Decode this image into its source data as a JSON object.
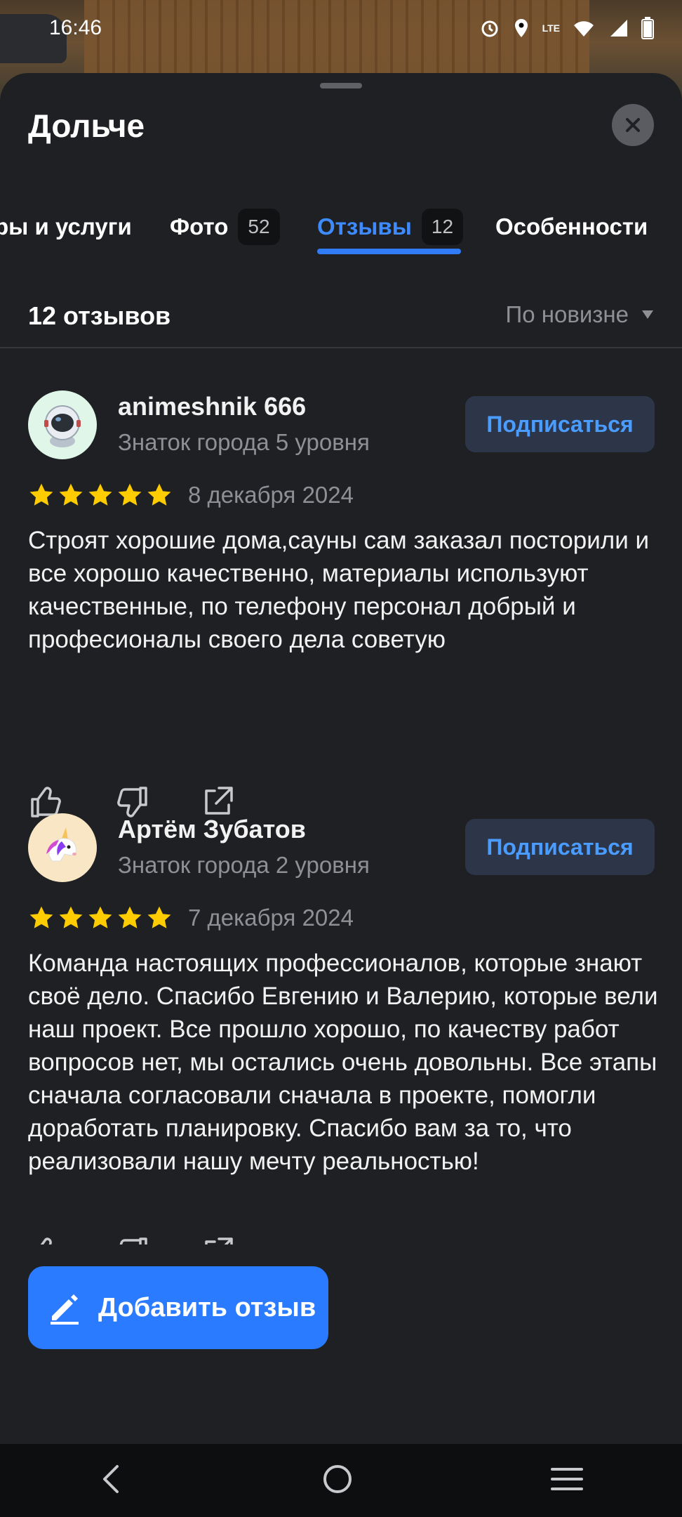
{
  "status_bar": {
    "time": "16:46",
    "network": "LTE"
  },
  "sheet": {
    "title": "Дольче"
  },
  "tabs": [
    {
      "label": "ры и услуги",
      "count": ""
    },
    {
      "label": "Фото",
      "count": "52"
    },
    {
      "label": "Отзывы",
      "count": "12",
      "active": true
    },
    {
      "label": "Особенности",
      "count": ""
    }
  ],
  "reviews": {
    "heading": "12 отзывов",
    "sort_label": "По новизне",
    "items": [
      {
        "author": "animeshnik 666",
        "level": "Знаток города 5 уровня",
        "subscribe_label": "Подписаться",
        "rating": 5,
        "date": "8 декабря 2024",
        "text": "Строят хорошие дома,сауны сам заказал посторили и все хорошо качественно, материалы используют качественные, по телефону персонал добрый и професионалы своего дела советую",
        "avatar_icon": "astronaut-avatar-icon"
      },
      {
        "author": "Артём Зубатов",
        "level": "Знаток города 2 уровня",
        "subscribe_label": "Подписаться",
        "rating": 5,
        "date": "7 декабря 2024",
        "text": "Команда настоящих профессионалов, которые знают своё дело. Спасибо Евгению и Валерию, которые вели наш проект. Все прошло хорошо, по качеству работ вопросов нет, мы остались очень довольны. Все этапы сначала согласовали сначала в проекте, помогли доработать планировку. Спасибо вам за то, что реализовали нашу мечту реальностью!",
        "avatar_icon": "unicorn-avatar-icon"
      }
    ]
  },
  "add_review": {
    "label": "Добавить отзыв"
  },
  "colors": {
    "accent": "#2a7bff",
    "star": "#ffcc00",
    "background": "#1f2023"
  }
}
